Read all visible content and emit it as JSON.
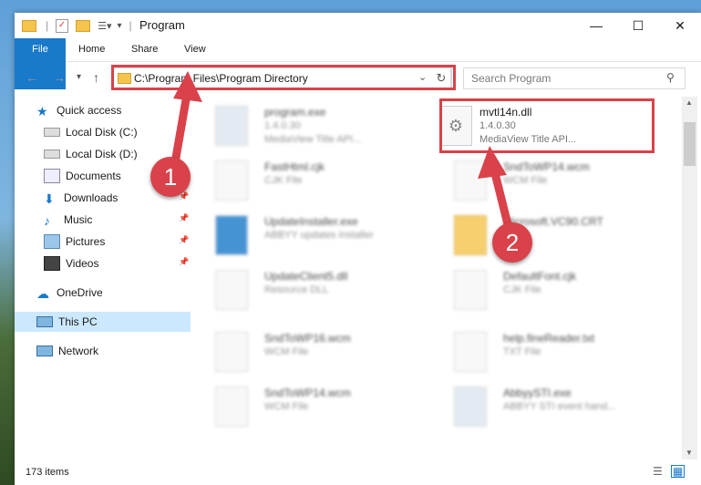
{
  "window": {
    "title": "Program",
    "controls": {
      "minimize": "—",
      "maximize": "☐",
      "close": "✕"
    }
  },
  "ribbon": {
    "tabs": [
      "File",
      "Home",
      "Share",
      "View"
    ]
  },
  "address": {
    "path": "C:\\Program Files\\Program Directory",
    "search_placeholder": "Search Program"
  },
  "navpane": {
    "items": [
      {
        "label": "Quick access"
      },
      {
        "label": "Local Disk (C:)"
      },
      {
        "label": "Local Disk (D:)"
      },
      {
        "label": "Documents"
      },
      {
        "label": "Downloads"
      },
      {
        "label": "Music"
      },
      {
        "label": "Pictures"
      },
      {
        "label": "Videos"
      },
      {
        "label": "OneDrive"
      },
      {
        "label": "This PC"
      },
      {
        "label": "Network"
      }
    ]
  },
  "files": {
    "f1": {
      "name": "program.exe",
      "line2": "1.4.0.30",
      "line3": "MediaView Title API..."
    },
    "f2": {
      "name": "mvtl14n.dll",
      "line2": "1.4.0.30",
      "line3": "MediaView Title API..."
    },
    "f3": {
      "name": "FastHtml.cjk",
      "line2": "CJK File"
    },
    "f4": {
      "name": "SndToWP14.wcm",
      "line2": "WCM File"
    },
    "f5": {
      "name": "UpdateInstaller.exe",
      "line2": "ABBYY updates installer"
    },
    "f6": {
      "name": "Microsoft.VC90.CRT",
      "line2": ""
    },
    "f7": {
      "name": "UpdateClient5.dll",
      "line2": "Resource DLL"
    },
    "f8": {
      "name": "DefaultFont.cjk",
      "line2": "CJK File"
    },
    "f9": {
      "name": "SndToWP16.wcm",
      "line2": "WCM File"
    },
    "f10": {
      "name": "help.fineReader.txt",
      "line2": "TXT File"
    },
    "f11": {
      "name": "SndToWP14.wcm",
      "line2": "WCM File"
    },
    "f12": {
      "name": "AbbyySTI.exe",
      "line2": "ABBYY STI event hand..."
    }
  },
  "status": {
    "count": "173 items"
  },
  "callouts": {
    "one": "1",
    "two": "2"
  },
  "colors": {
    "accent": "#1979ca",
    "highlight": "#d9424a",
    "selected": "#cce8ff"
  }
}
